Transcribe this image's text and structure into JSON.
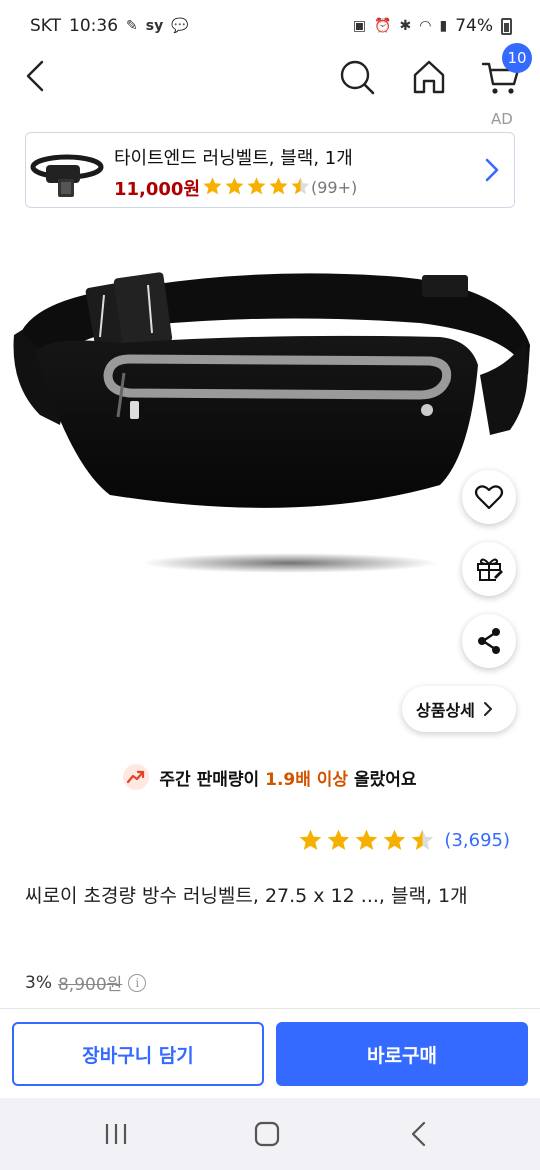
{
  "status_bar": {
    "carrier": "SKT",
    "time": "10:36",
    "app_text": "sy",
    "battery": "74%"
  },
  "header": {
    "cart_count": "10"
  },
  "ad": {
    "label": "AD",
    "title": "타이트엔드 러닝벨트, 블랙, 1개",
    "price": "11,000원",
    "rating": 4.5,
    "reviews": "(99+)"
  },
  "actions": {
    "detail_label": "상품상세"
  },
  "trend": {
    "prefix": "주간 판매량이 ",
    "highlight": "1.9배 이상",
    "suffix": " 올랐어요"
  },
  "product": {
    "rating": 4.5,
    "rating_count": "(3,695)",
    "title": "씨로이 초경량 방수 러닝벨트, 27.5 x 12 ..., 블랙, 1개",
    "discount": "3%",
    "original_price": "8,900원"
  },
  "bottom_bar": {
    "add_to_cart": "장바구니 담기",
    "buy_now": "바로구매"
  },
  "colors": {
    "accent": "#346aff",
    "ad_price": "#ae0000",
    "star": "#f5b000",
    "trend_highlight": "#d35400"
  }
}
